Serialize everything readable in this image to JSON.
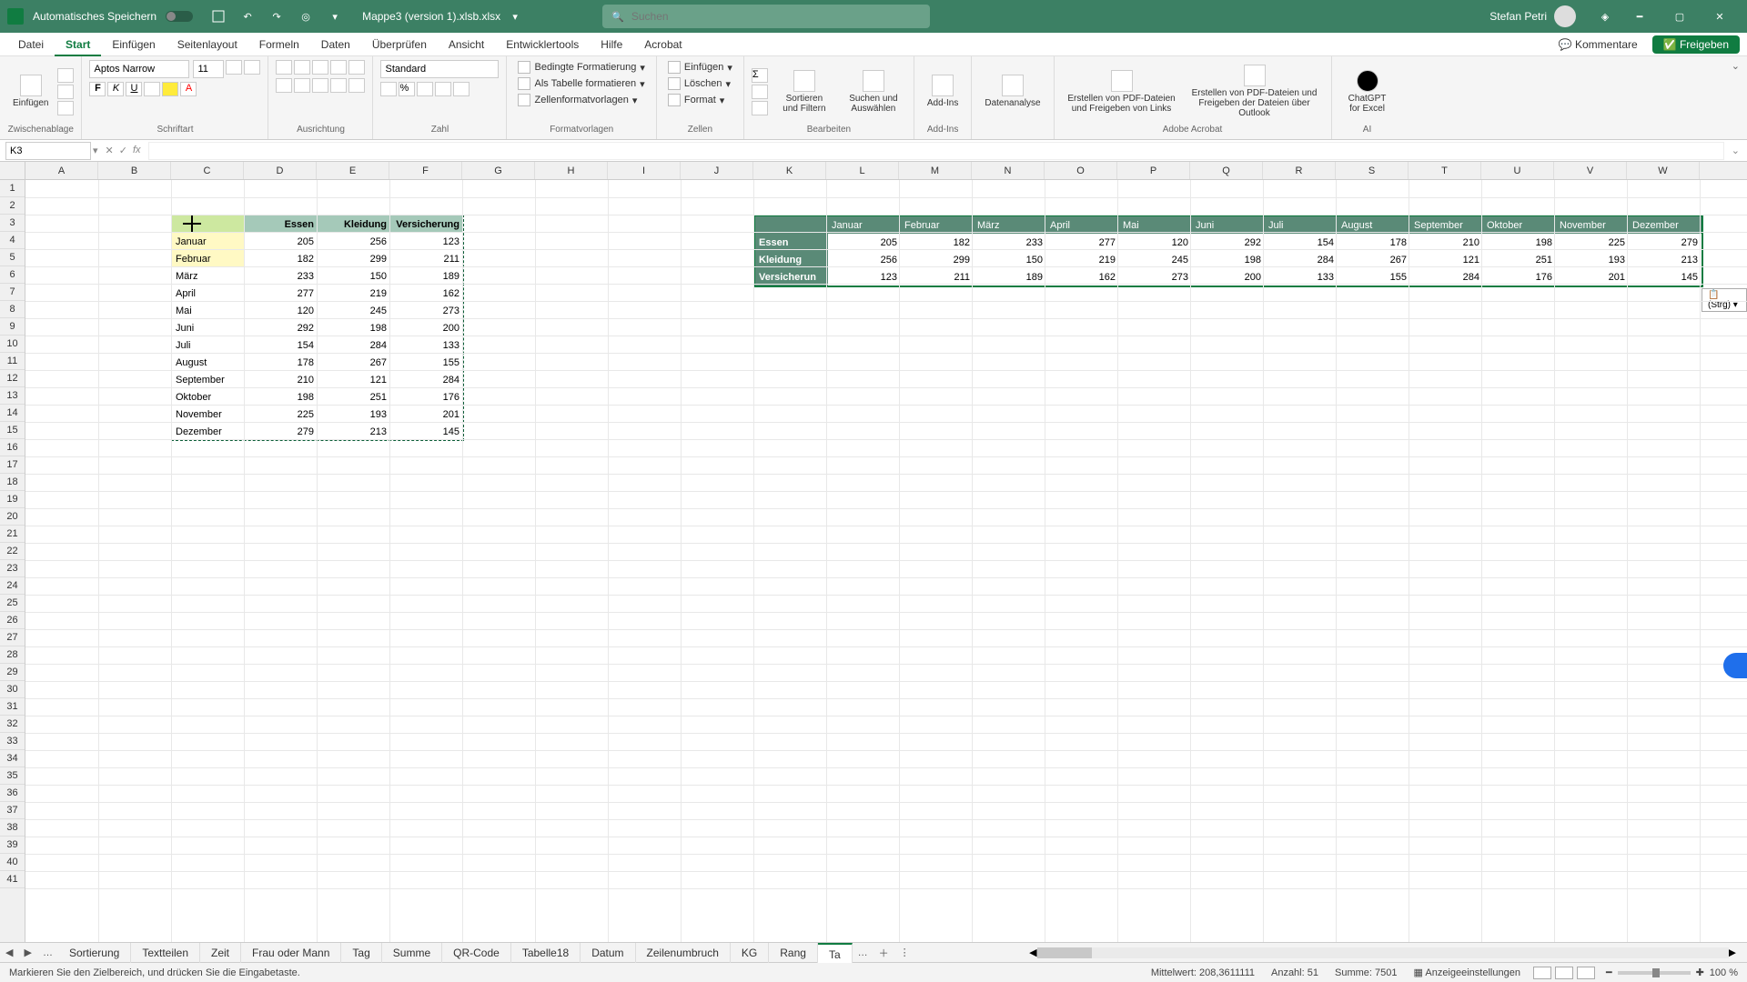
{
  "title": {
    "autosave": "Automatisches Speichern",
    "filename": "Mappe3 (version 1).xlsb.xlsx",
    "search_placeholder": "Suchen",
    "user": "Stefan Petri"
  },
  "tabs": {
    "items": [
      "Datei",
      "Start",
      "Einfügen",
      "Seitenlayout",
      "Formeln",
      "Daten",
      "Überprüfen",
      "Ansicht",
      "Entwicklertools",
      "Hilfe",
      "Acrobat"
    ],
    "active": 1,
    "comments": "Kommentare",
    "share": "Freigeben"
  },
  "ribbon": {
    "clipboard": {
      "paste": "Einfügen",
      "label": "Zwischenablage"
    },
    "font": {
      "name": "Aptos Narrow",
      "size": "11",
      "label": "Schriftart"
    },
    "alignment": {
      "label": "Ausrichtung"
    },
    "number": {
      "format": "Standard",
      "label": "Zahl"
    },
    "styles": {
      "cond": "Bedingte Formatierung",
      "table": "Als Tabelle formatieren",
      "cell": "Zellenformatvorlagen",
      "label": "Formatvorlagen"
    },
    "cells": {
      "insert": "Einfügen",
      "delete": "Löschen",
      "format": "Format",
      "label": "Zellen"
    },
    "editing": {
      "sort": "Sortieren und Filtern",
      "find": "Suchen und Auswählen",
      "label": "Bearbeiten"
    },
    "addins": {
      "addins": "Add-Ins",
      "label": "Add-Ins"
    },
    "analysis": {
      "label": "Datenanalyse"
    },
    "acrobat": {
      "create1": "Erstellen von PDF-Dateien und Freigeben von Links",
      "create2": "Erstellen von PDF-Dateien und Freigeben der Dateien über Outlook",
      "label": "Adobe Acrobat"
    },
    "ai": {
      "gpt": "ChatGPT for Excel",
      "label": "AI"
    }
  },
  "namebox": {
    "ref": "K3"
  },
  "columns": [
    "A",
    "B",
    "C",
    "D",
    "E",
    "F",
    "G",
    "H",
    "I",
    "J",
    "K",
    "L",
    "M",
    "N",
    "O",
    "P",
    "Q",
    "R",
    "S",
    "T",
    "U",
    "V",
    "W"
  ],
  "table1": {
    "headers": [
      "",
      "Essen",
      "Kleidung",
      "Versicherung"
    ],
    "rows": [
      [
        "Januar",
        205,
        256,
        123
      ],
      [
        "Februar",
        182,
        299,
        211
      ],
      [
        "März",
        233,
        150,
        189
      ],
      [
        "April",
        277,
        219,
        162
      ],
      [
        "Mai",
        120,
        245,
        273
      ],
      [
        "Juni",
        292,
        198,
        200
      ],
      [
        "Juli",
        154,
        284,
        133
      ],
      [
        "August",
        178,
        267,
        155
      ],
      [
        "September",
        210,
        121,
        284
      ],
      [
        "Oktober",
        198,
        251,
        176
      ],
      [
        "November",
        225,
        193,
        201
      ],
      [
        "Dezember",
        279,
        213,
        145
      ]
    ]
  },
  "table2": {
    "headers": [
      "",
      "Januar",
      "Februar",
      "März",
      "April",
      "Mai",
      "Juni",
      "Juli",
      "August",
      "September",
      "Oktober",
      "November",
      "Dezember"
    ],
    "rows": [
      [
        "Essen",
        205,
        182,
        233,
        277,
        120,
        292,
        154,
        178,
        210,
        198,
        225,
        279
      ],
      [
        "Kleidung",
        256,
        299,
        150,
        219,
        245,
        198,
        284,
        267,
        121,
        251,
        193,
        213
      ],
      [
        "Versicherun",
        123,
        211,
        189,
        162,
        273,
        200,
        133,
        155,
        284,
        176,
        201,
        145
      ]
    ]
  },
  "paste_smart": "(Strg)",
  "sheets": {
    "items": [
      "Sortierung",
      "Textteilen",
      "Zeit",
      "Frau oder Mann",
      "Tag",
      "Summe",
      "QR-Code",
      "Tabelle18",
      "Datum",
      "Zeilenumbruch",
      "KG",
      "Rang",
      "Ta"
    ],
    "active": 12
  },
  "status": {
    "left": "Markieren Sie den Zielbereich, und drücken Sie die Eingabetaste.",
    "avg_label": "Mittelwert:",
    "avg": "208,3611111",
    "count_label": "Anzahl:",
    "count": "51",
    "sum_label": "Summe:",
    "sum": "7501",
    "display": "Anzeigeeinstellungen",
    "zoom": "100 %"
  }
}
